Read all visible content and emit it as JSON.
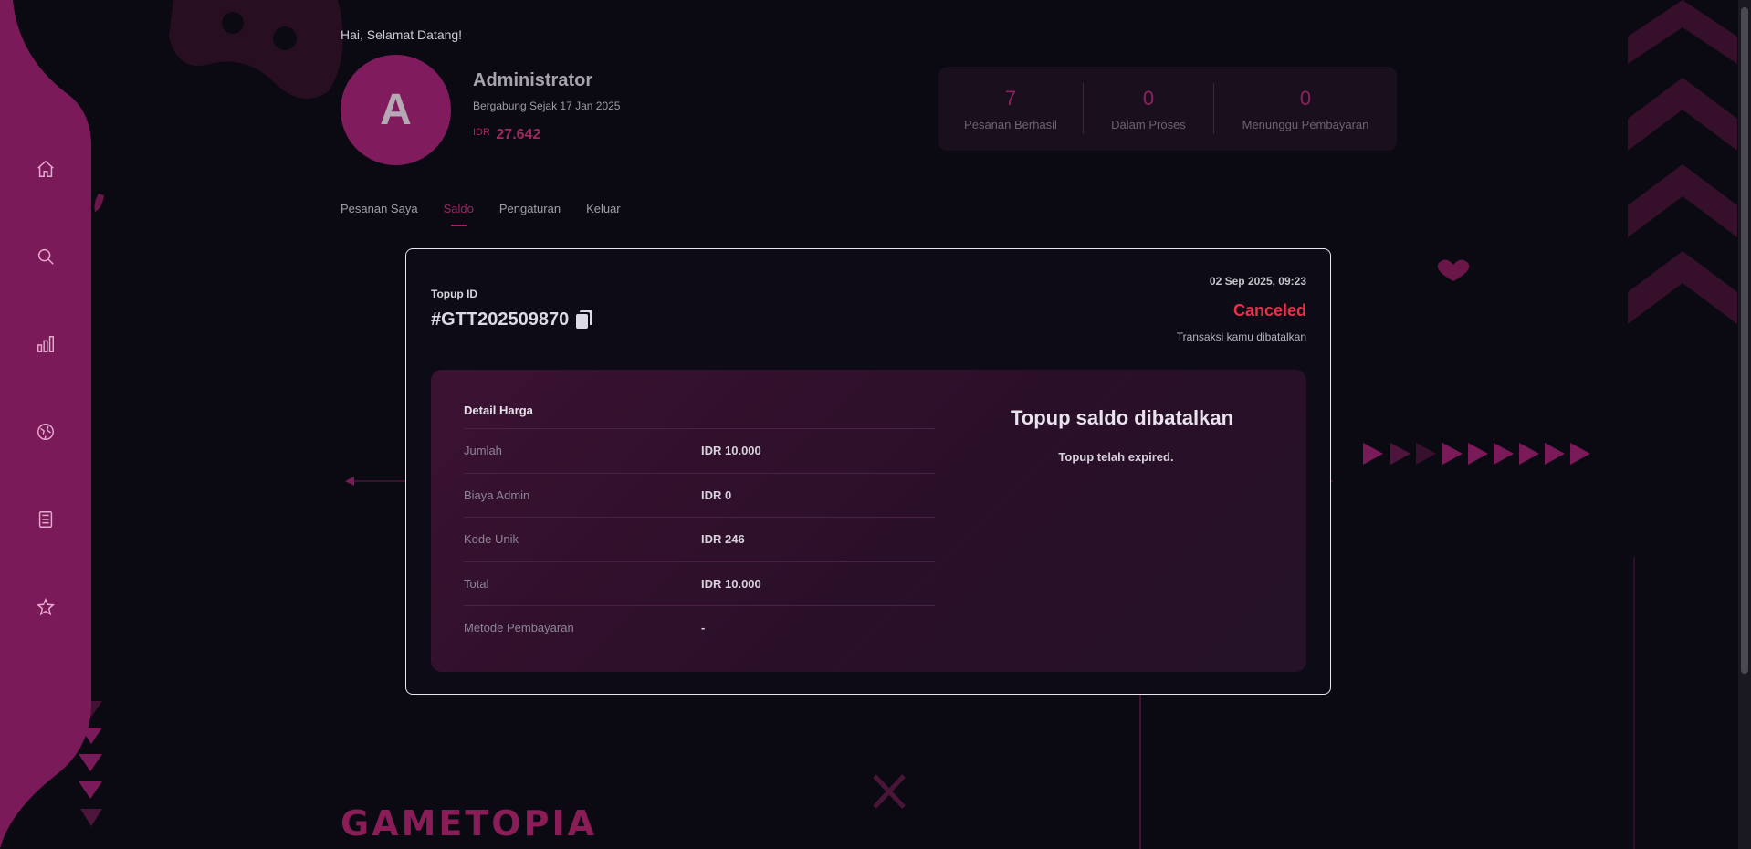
{
  "greeting": "Hai, Selamat Datang!",
  "user": {
    "avatar_letter": "A",
    "name": "Administrator",
    "joined": "Bergabung Sejak 17 Jan 2025",
    "balance_currency": "IDR",
    "balance_amount": "27.642"
  },
  "stats": [
    {
      "value": "7",
      "label": "Pesanan Berhasil"
    },
    {
      "value": "0",
      "label": "Dalam Proses"
    },
    {
      "value": "0",
      "label": "Menunggu Pembayaran"
    }
  ],
  "tabs": [
    {
      "label": "Pesanan Saya"
    },
    {
      "label": "Saldo"
    },
    {
      "label": "Pengaturan"
    },
    {
      "label": "Keluar"
    }
  ],
  "active_tab": "Saldo",
  "sidebar": {
    "items": [
      {
        "icon": "home-icon"
      },
      {
        "icon": "search-icon"
      },
      {
        "icon": "bar-chart-icon"
      },
      {
        "icon": "globe-icon"
      },
      {
        "icon": "calculator-icon"
      },
      {
        "icon": "star-icon"
      }
    ]
  },
  "topup": {
    "id_label": "Topup ID",
    "id": "#GTT202509870",
    "date": "02 Sep 2025, 09:23",
    "status": "Canceled",
    "status_desc": "Transaksi kamu dibatalkan",
    "detail_title": "Detail Harga",
    "rows": [
      {
        "label": "Jumlah",
        "value": "IDR 10.000"
      },
      {
        "label": "Biaya Admin",
        "value": "IDR 0"
      },
      {
        "label": "Kode Unik",
        "value": "IDR 246"
      },
      {
        "label": "Total",
        "value": "IDR 10.000"
      },
      {
        "label": "Metode Pembayaran",
        "value": "-"
      }
    ],
    "result_title": "Topup saldo dibatalkan",
    "result_desc": "Topup telah expired."
  },
  "logo": "GAMETOPIA",
  "colors": {
    "accent": "#9c2466",
    "status_canceled": "#e8304a",
    "sidebar": "#7a1a58",
    "background": "#0b0a12"
  }
}
